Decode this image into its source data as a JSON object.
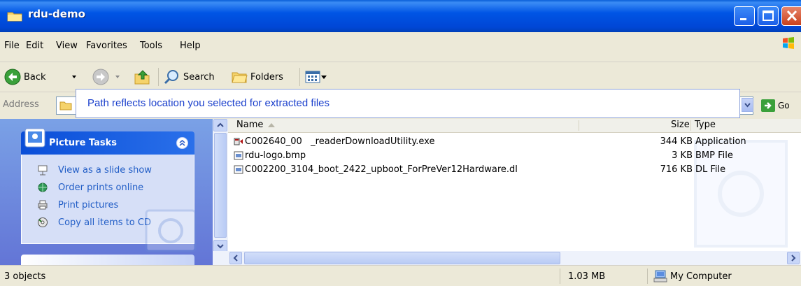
{
  "window": {
    "title": "rdu-demo"
  },
  "menu": {
    "items": [
      "File",
      "Edit",
      "View",
      "Favorites",
      "Tools",
      "Help"
    ]
  },
  "toolbar": {
    "back_label": "Back",
    "search_label": "Search",
    "folders_label": "Folders"
  },
  "address": {
    "label": "Address",
    "go_label": "Go"
  },
  "callout": {
    "text": "Path reflects location you selected for extracted files"
  },
  "tasks": {
    "title": "Picture Tasks",
    "links": [
      "View as a slide show",
      "Order prints online",
      "Print pictures",
      "Copy all items to CD"
    ]
  },
  "filelist": {
    "columns": {
      "name": "Name",
      "size": "Size",
      "type": "Type"
    },
    "rows": [
      {
        "name": "C002640_00   _readerDownloadUtility.exe",
        "size": "344 KB",
        "type": "Application",
        "icon": "exe-icon"
      },
      {
        "name": "rdu-logo.bmp",
        "size": "3 KB",
        "type": "BMP File",
        "icon": "bmp-file-icon"
      },
      {
        "name": "C002200_3104_boot_2422_upboot_ForPreVer12Hardware.dl",
        "size": "716 KB",
        "type": "DL File",
        "icon": "dl-file-icon"
      }
    ]
  },
  "status": {
    "objects": "3 objects",
    "total_size": "1.03 MB",
    "zone": "My Computer"
  },
  "colors": {
    "titlebar": "#0055e5",
    "callout_text": "#1a3fcc",
    "task_link": "#215dc6"
  }
}
